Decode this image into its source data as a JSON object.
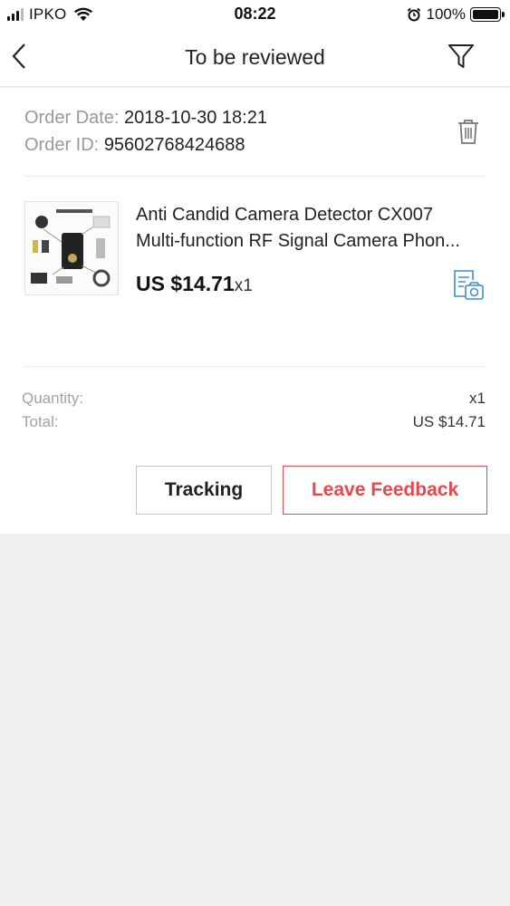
{
  "status_bar": {
    "carrier": "IPKO",
    "time": "08:22",
    "battery": "100%",
    "icons": [
      "signal-icon",
      "wifi-icon",
      "alarm-icon",
      "battery-icon"
    ]
  },
  "header": {
    "title": "To be reviewed",
    "back_icon": "back-chevron-icon",
    "filter_icon": "filter-icon"
  },
  "order": {
    "date_label": "Order Date:",
    "date_value": "2018-10-30 18:21",
    "id_label": "Order ID:",
    "id_value": "95602768424688",
    "delete_icon": "trash-icon"
  },
  "product": {
    "title_line1": "Anti Candid Camera Detector CX007",
    "title_line2": "Multi-function RF Signal Camera Phon...",
    "price": "US $14.71",
    "qty": "x1",
    "review_icon": "photo-review-icon"
  },
  "summary": {
    "quantity_label": "Quantity:",
    "quantity_value": "x1",
    "total_label": "Total:",
    "total_value": "US $14.71"
  },
  "actions": {
    "tracking_label": "Tracking",
    "feedback_label": "Leave Feedback"
  },
  "colors": {
    "accent": "#e8474d",
    "link_blue": "#3b8ed8",
    "page_bg": "#efefef"
  }
}
